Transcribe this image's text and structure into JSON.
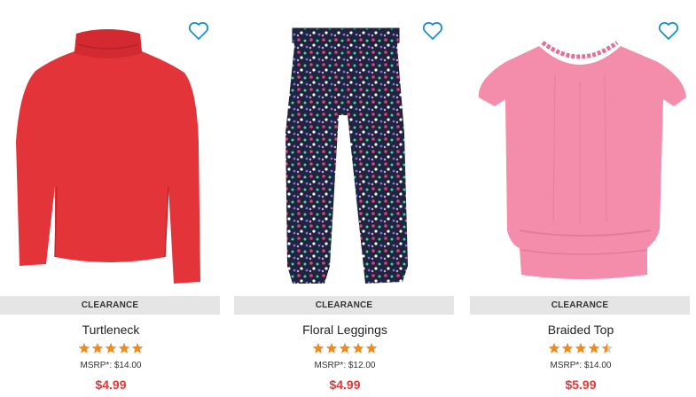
{
  "products": [
    {
      "badge": "CLEARANCE",
      "name": "Turtleneck",
      "rating": 5,
      "msrp": "MSRP*: $14.00",
      "price": "$4.99",
      "image": "red-turtleneck",
      "favorite_icon": "heart-outline-icon"
    },
    {
      "badge": "CLEARANCE",
      "name": "Floral Leggings",
      "rating": 5,
      "msrp": "MSRP*: $12.00",
      "price": "$4.99",
      "image": "floral-leggings",
      "favorite_icon": "heart-outline-icon"
    },
    {
      "badge": "CLEARANCE",
      "name": "Braided Top",
      "rating": 4.5,
      "msrp": "MSRP*: $14.00",
      "price": "$5.99",
      "image": "pink-braided-top",
      "favorite_icon": "heart-outline-icon"
    }
  ],
  "colors": {
    "star_filled": "#f08c1e",
    "star_empty": "#cccccc",
    "price": "#e03a3a",
    "heart": "#1b8fc6",
    "badge_bg": "#e5e5e5"
  }
}
